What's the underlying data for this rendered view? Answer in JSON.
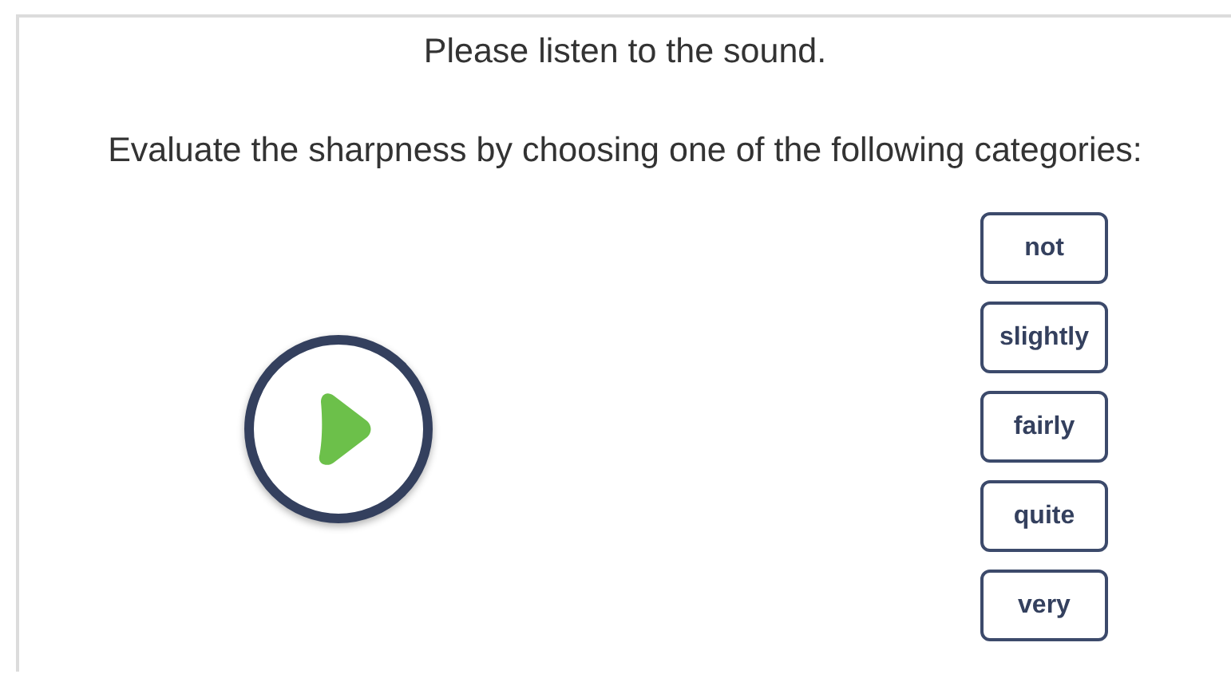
{
  "instructions": [
    "Please listen to the sound.",
    "Evaluate the sharpness by choosing one of the following categories:"
  ],
  "categories": [
    {
      "label": "not",
      "selected": false
    },
    {
      "label": "slightly",
      "selected": false
    },
    {
      "label": "fairly",
      "selected": false
    },
    {
      "label": "quite",
      "selected": false
    },
    {
      "label": "very",
      "selected": false
    }
  ]
}
